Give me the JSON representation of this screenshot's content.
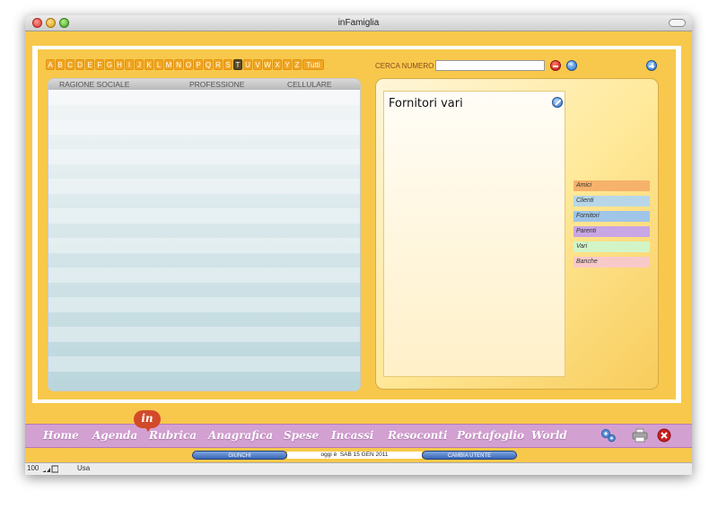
{
  "window": {
    "title": "inFamiglia"
  },
  "alphabet": {
    "letters": [
      "A",
      "B",
      "C",
      "D",
      "E",
      "F",
      "G",
      "H",
      "I",
      "J",
      "K",
      "L",
      "M",
      "N",
      "O",
      "P",
      "Q",
      "R",
      "S",
      "T",
      "U",
      "V",
      "W",
      "X",
      "Y",
      "Z"
    ],
    "all_label": "Tutti",
    "selected": "T"
  },
  "list": {
    "columns": [
      "RAGIONE SOCIALE",
      "PROFESSIONE",
      "CELLULARE"
    ]
  },
  "search": {
    "label": "CERCA NUMERO",
    "value": ""
  },
  "detail": {
    "title": "Fornitori vari"
  },
  "categories": [
    {
      "label": "Amici",
      "color": "#f6b26b"
    },
    {
      "label": "Clienti",
      "color": "#b7d7e8"
    },
    {
      "label": "Fornitori",
      "color": "#9fc5e8"
    },
    {
      "label": "Parenti",
      "color": "#c9a6e4"
    },
    {
      "label": "Vari",
      "color": "#d2f5c8"
    },
    {
      "label": "Banche",
      "color": "#f8c9c9"
    }
  ],
  "nav": {
    "items": [
      "Home",
      "Agenda",
      "Rubrica",
      "Anagrafica",
      "Spese",
      "Incassi",
      "Resoconti",
      "Portafoglio",
      "World"
    ],
    "badge": "in"
  },
  "status": {
    "left_button": "GIUNCHI",
    "today_label": "oggi è",
    "date": "SAB 15 GEN 2011",
    "right_button": "CAMBIA UTENTE"
  },
  "bottombar": {
    "zoom": "100",
    "mode": "Usa"
  }
}
